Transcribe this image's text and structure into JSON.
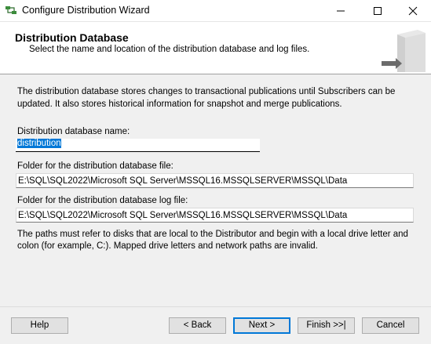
{
  "window": {
    "title": "Configure Distribution Wizard"
  },
  "header": {
    "title": "Distribution Database",
    "subtitle": "Select the name and location of the distribution database and log files."
  },
  "intro_text": "The distribution database stores changes to transactional publications until Subscribers can be updated. It also stores historical information for snapshot and merge publications.",
  "form": {
    "db_name_label": "Distribution database name:",
    "db_name_value": "distribution",
    "db_file_folder_label": "Folder for the distribution database file:",
    "db_file_folder_value": "E:\\SQL\\SQL2022\\Microsoft SQL Server\\MSSQL16.MSSQLSERVER\\MSSQL\\Data",
    "log_file_folder_label": "Folder for the distribution database log file:",
    "log_file_folder_value": "E:\\SQL\\SQL2022\\Microsoft SQL Server\\MSSQL16.MSSQLSERVER\\MSSQL\\Data"
  },
  "note_text": "The paths must refer to disks that are local to the Distributor and begin with a local drive letter and colon (for example, C:). Mapped drive letters and network paths are invalid.",
  "buttons": {
    "help": "Help",
    "back": "< Back",
    "next": "Next >",
    "finish": "Finish >>|",
    "cancel": "Cancel"
  },
  "colors": {
    "accent": "#0078d7",
    "dialog_bg": "#f0f0f0",
    "button_bg": "#e1e1e1"
  },
  "icons": [
    "wizard-app-icon",
    "minimize-icon",
    "maximize-icon",
    "close-icon",
    "server-graphic-icon"
  ]
}
